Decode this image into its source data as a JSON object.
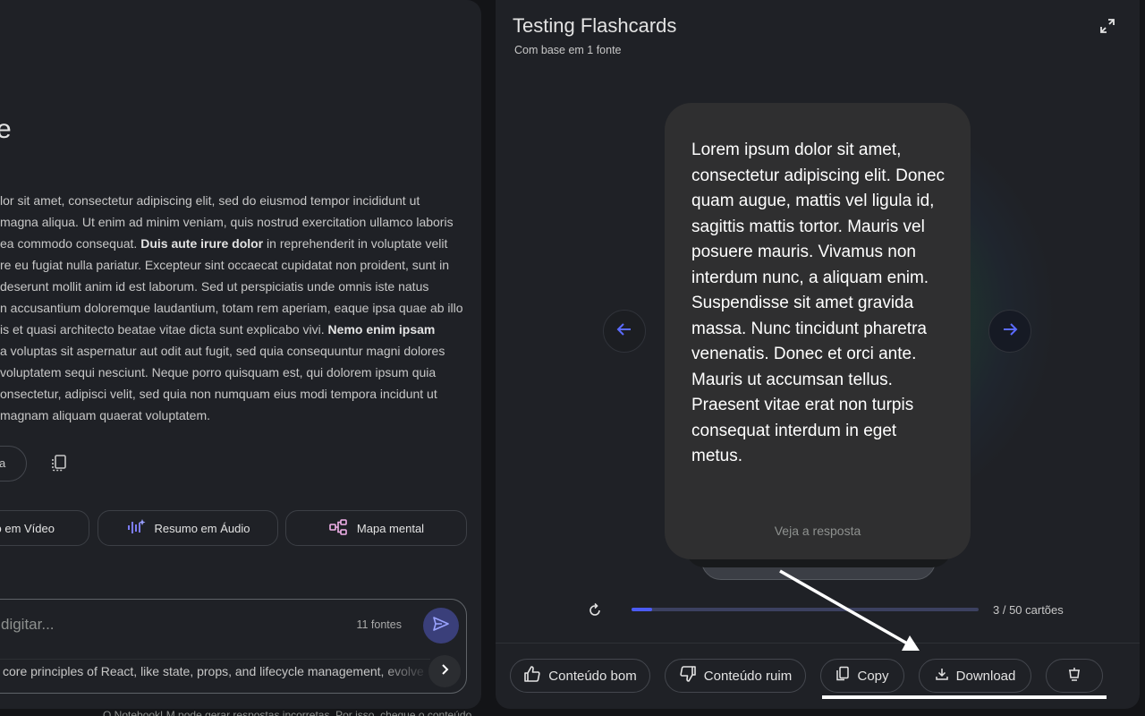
{
  "left": {
    "heading": "e",
    "body_lines": [
      {
        "parts": [
          {
            "t": "lor sit amet, consectetur adipiscing elit, sed do eiusmod tempor incididunt ut",
            "b": false
          }
        ]
      },
      {
        "parts": [
          {
            "t": " magna aliqua. Ut enim ad minim veniam, quis nostrud exercitation ullamco laboris",
            "b": false
          }
        ]
      },
      {
        "parts": [
          {
            "t": " ea commodo consequat. ",
            "b": false
          },
          {
            "t": "Duis aute irure dolor",
            "b": true
          },
          {
            "t": " in reprehenderit in voluptate velit",
            "b": false
          }
        ]
      },
      {
        "parts": [
          {
            "t": "re eu fugiat nulla pariatur. Excepteur sint occaecat cupidatat non proident, sunt in",
            "b": false
          }
        ]
      },
      {
        "parts": [
          {
            "t": " deserunt mollit anim id est laborum. Sed ut perspiciatis unde omnis iste natus",
            "b": false
          }
        ]
      },
      {
        "parts": [
          {
            "t": "n accusantium doloremque laudantium, totam rem aperiam, eaque ipsa quae ab illo",
            "b": false
          }
        ]
      },
      {
        "parts": [
          {
            "t": "is et quasi architecto beatae vitae dicta sunt explicabo vivi. ",
            "b": false
          },
          {
            "t": "Nemo enim ipsam",
            "b": true
          }
        ]
      },
      {
        "parts": [
          {
            "t": "a voluptas sit aspernatur aut odit aut fugit, sed quia consequuntur magni dolores",
            "b": false
          }
        ]
      },
      {
        "parts": [
          {
            "t": "voluptatem sequi nesciunt. Neque porro quisquam est, qui dolorem ipsum quia",
            "b": false
          }
        ]
      },
      {
        "parts": [
          {
            "t": "onsectetur, adipisci velit, sed quia non numquam eius modi tempora incidunt ut",
            "b": false
          }
        ]
      },
      {
        "parts": [
          {
            "t": " magnam aliquam quaerat voluptatem.",
            "b": false
          }
        ]
      }
    ],
    "note_pill_label": "a",
    "studio": {
      "video_label": "o em Vídeo",
      "audio_label": "Resumo em Áudio",
      "mindmap_label": "Mapa mental"
    },
    "chat": {
      "placeholder": "digitar...",
      "sources": "11 fontes",
      "suggestion": "core principles of React, like state, props, and lifecycle management, evolve"
    },
    "disclaimer": "O NotebookLM pode gerar respostas incorretas. Por isso, cheque o conteúdo"
  },
  "right": {
    "title": "Testing Flashcards",
    "subtitle": "Com base em 1 fonte",
    "card_text": "Lorem ipsum dolor sit amet, consectetur adipiscing elit. Donec quam augue, mattis vel ligula id, sagittis mattis tortor. Mauris vel posuere mauris. Vivamus non interdum nunc, a aliquam enim. Suspendisse sit amet gravida massa. Nunc tincidunt pharetra venenatis. Donec et orci ante. Mauris ut accumsan tellus. Praesent vitae erat non turpis consequat interdum in eget metus.",
    "reveal_label": "Veja a resposta",
    "progress": {
      "current": 3,
      "total": 50,
      "label": "3 / 50 cartões"
    },
    "actions": {
      "good": "Conteúdo bom",
      "bad": "Conteúdo ruim",
      "copy": "Copy",
      "download": "Download"
    }
  },
  "colors": {
    "accent": "#4b5bf5",
    "panel_bg": "#1f2126",
    "card_bg": "#2f2f30",
    "glow": "#2a9646"
  }
}
